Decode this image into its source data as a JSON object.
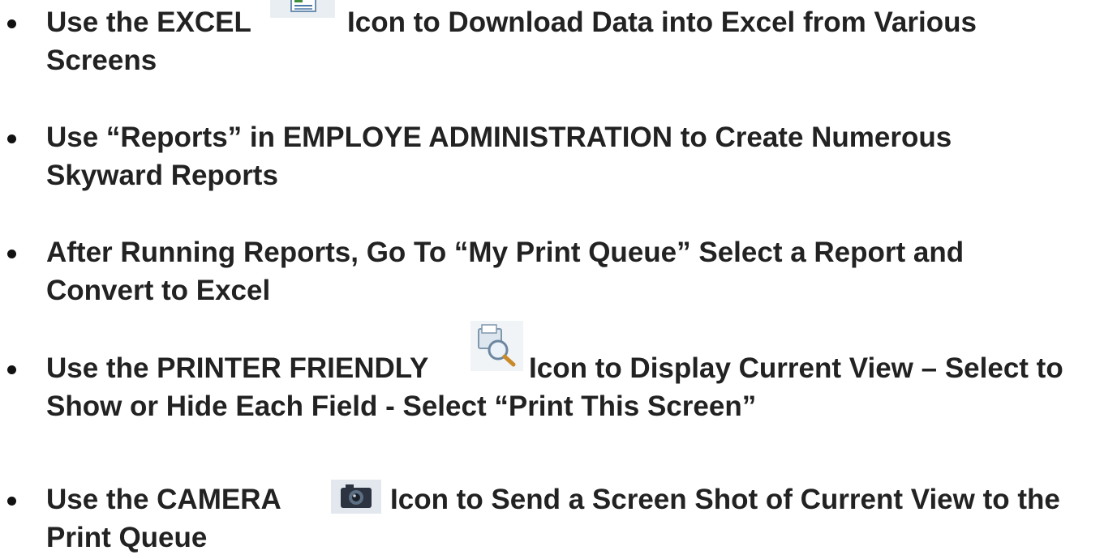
{
  "bullets": [
    {
      "before_icon": "Use the EXCEL",
      "icon": "excel-icon",
      "after_icon": "Icon to Download Data into Excel from Various",
      "line2": "Screens"
    },
    {
      "line1": "Use “Reports” in EMPLOYE ADMINISTRATION to Create Numerous",
      "line2": "Skyward Reports"
    },
    {
      "line1": "After Running Reports, Go To “My Print Queue” Select a Report and",
      "line2": "Convert to Excel"
    },
    {
      "before_icon": "Use the PRINTER FRIENDLY",
      "icon": "printer-friendly-icon",
      "after_icon": "Icon to Display Current View – Select to",
      "line2": "Show or Hide Each Field - Select “Print This Screen”"
    },
    {
      "before_icon": "Use the CAMERA",
      "icon": "camera-icon",
      "after_icon": "Icon to Send a Screen Shot of Current View to the",
      "line2": "Print Queue"
    }
  ],
  "colors": {
    "text": "#222222",
    "bullet": "#111111",
    "background": "#ffffff"
  }
}
